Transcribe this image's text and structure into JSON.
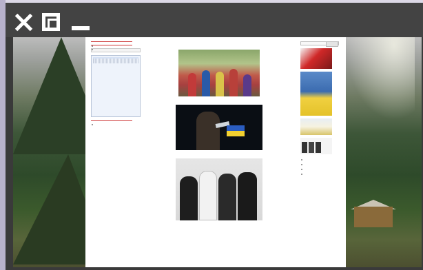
{
  "window": {
    "controls": [
      "close-icon",
      "maximize-icon",
      "minimize-icon"
    ],
    "colors": {
      "titlebar": "#434343",
      "accent": "#e24a4a",
      "background_page": "#ffffff"
    }
  },
  "site": {
    "left_sidebar": {
      "sections": [
        {
          "title": "",
          "items": [
            "",
            "",
            "",
            "",
            ""
          ]
        },
        {
          "title": "",
          "items": [
            "",
            "",
            "",
            "",
            "",
            ""
          ]
        }
      ],
      "widget": {
        "title": "",
        "text": ""
      },
      "box": {
        "head": "",
        "lines": [
          "",
          "",
          "",
          "",
          "",
          "",
          ""
        ]
      },
      "section3": {
        "title": "",
        "items": [
          "",
          "",
          "",
          ""
        ]
      }
    },
    "center": {
      "heading": "",
      "posts": [
        {
          "title": "",
          "image": "folk-dance-photo"
        },
        {
          "title": "",
          "image": "concert-singer-photo"
        },
        {
          "title": "",
          "image": "band-photo"
        }
      ]
    },
    "right_sidebar": {
      "search_label": "",
      "blocks": [
        "",
        "",
        "",
        "",
        ""
      ]
    }
  }
}
